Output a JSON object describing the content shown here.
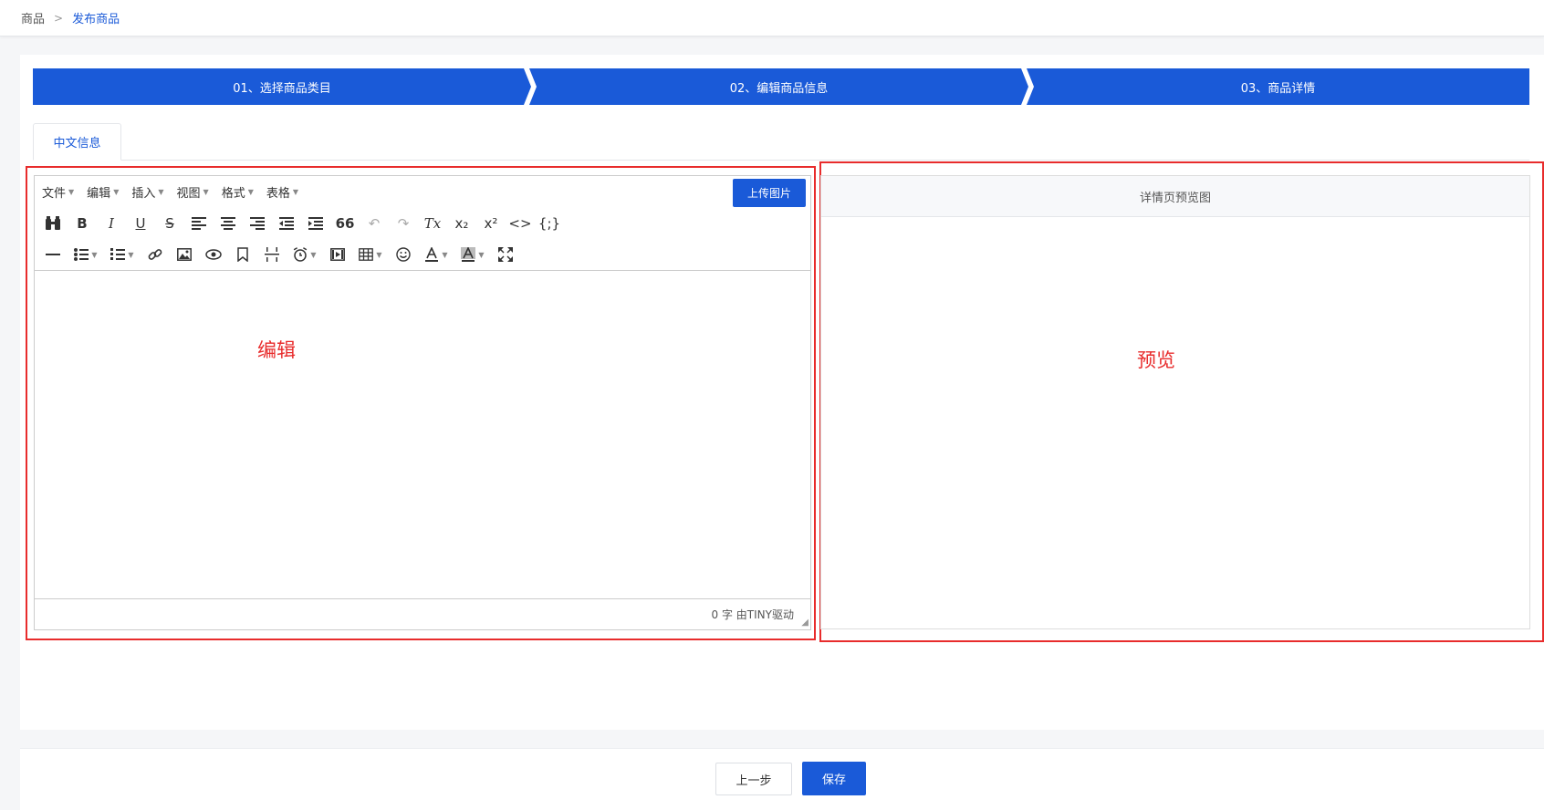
{
  "breadcrumb": {
    "root": "商品",
    "separator": ">",
    "current": "发布商品"
  },
  "steps": [
    {
      "label": "01、选择商品类目"
    },
    {
      "label": "02、编辑商品信息"
    },
    {
      "label": "03、商品详情"
    }
  ],
  "tabs": [
    {
      "label": "中文信息",
      "active": true
    }
  ],
  "editor": {
    "menus": [
      {
        "label": "文件"
      },
      {
        "label": "编辑"
      },
      {
        "label": "插入"
      },
      {
        "label": "视图"
      },
      {
        "label": "格式"
      },
      {
        "label": "表格"
      }
    ],
    "upload_button": "上传图片",
    "toolbar_row1": {
      "bold": "B",
      "italic": "I",
      "underline": "U",
      "strikethrough": "S",
      "blockquote": "66",
      "clear_format": "Tx",
      "subscript": "x₂",
      "superscript": "x²",
      "code": "<>",
      "template": "{;}"
    },
    "status": "0 字 由TINY驱动"
  },
  "preview": {
    "header": "详情页预览图"
  },
  "annotations": {
    "edit": "编辑",
    "preview": "预览"
  },
  "footer": {
    "prev_button": "上一步",
    "save_button": "保存"
  },
  "colors": {
    "primary": "#1a5ad8",
    "annotation": "#e82c2c"
  }
}
